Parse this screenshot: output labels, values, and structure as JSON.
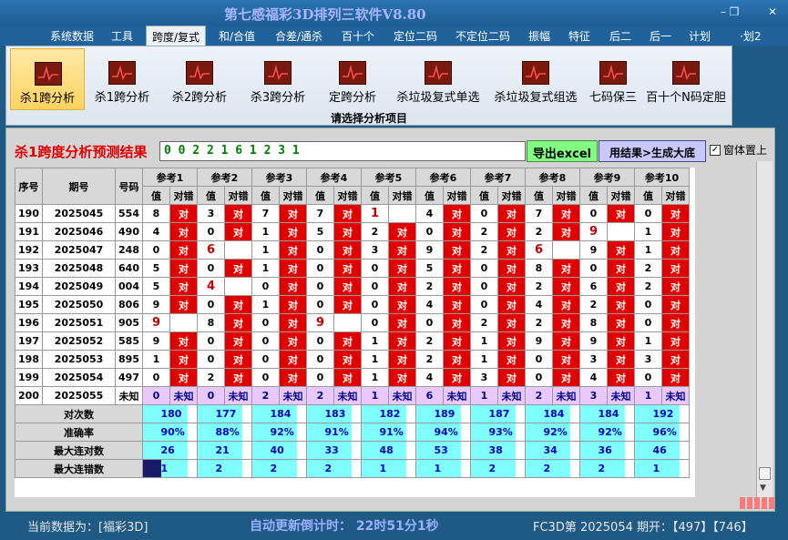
{
  "window": {
    "title": "第七感福彩3D排列三软件V8.80",
    "controls": [
      "–",
      "❐",
      "✕"
    ]
  },
  "menu": [
    "系统数据",
    "工具",
    "跨度/复式",
    "和/合值",
    "合差/通杀",
    "百十个",
    "定位二码",
    "不定位二码",
    "振幅",
    "特征",
    "后二",
    "后一",
    "计划",
    "·划2"
  ],
  "menu_active": 2,
  "ribbon": {
    "tools": [
      "杀1跨分析",
      "杀1跨分析",
      "杀2跨分析",
      "杀3跨分析",
      "定跨分析",
      "杀垃圾复式单选",
      "杀垃圾复式组选",
      "七码保三",
      "百十个N码定胆"
    ],
    "active": 0,
    "caption": "请选择分析项目"
  },
  "panel": {
    "title": "杀1跨度分析预测结果",
    "result": "0 0 2 2 1 6 1 2 3 1",
    "excel_button": "导出excel",
    "gen_button": "用结果>生成大底",
    "ontop_label": "窗体置上",
    "ontop_checked": "✓"
  },
  "table": {
    "headers": {
      "idx": "序号",
      "period": "期号",
      "num": "号码",
      "refs": [
        "参考1",
        "参考2",
        "参考3",
        "参考4",
        "参考5",
        "参考6",
        "参考7",
        "参考8",
        "参考9",
        "参考10"
      ],
      "val": "值",
      "hit": "对错"
    },
    "rows": [
      {
        "idx": "190",
        "period": "2025045",
        "num": "554",
        "cells": [
          [
            "8",
            "对"
          ],
          [
            "3",
            "对"
          ],
          [
            "7",
            "对"
          ],
          [
            "7",
            "对"
          ],
          [
            "1",
            ""
          ],
          [
            "4",
            "对"
          ],
          [
            "0",
            "对"
          ],
          [
            "7",
            "对"
          ],
          [
            "0",
            "对"
          ],
          [
            "0",
            "对"
          ]
        ]
      },
      {
        "idx": "191",
        "period": "2025046",
        "num": "490",
        "cells": [
          [
            "4",
            "对"
          ],
          [
            "0",
            "对"
          ],
          [
            "1",
            "对"
          ],
          [
            "5",
            "对"
          ],
          [
            "2",
            "对"
          ],
          [
            "0",
            "对"
          ],
          [
            "2",
            "对"
          ],
          [
            "2",
            "对"
          ],
          [
            "9",
            ""
          ],
          [
            "1",
            "对"
          ]
        ]
      },
      {
        "idx": "192",
        "period": "2025047",
        "num": "248",
        "cells": [
          [
            "0",
            "对"
          ],
          [
            "6",
            ""
          ],
          [
            "1",
            "对"
          ],
          [
            "0",
            "对"
          ],
          [
            "3",
            "对"
          ],
          [
            "9",
            "对"
          ],
          [
            "2",
            "对"
          ],
          [
            "6",
            ""
          ],
          [
            "9",
            "对"
          ],
          [
            "1",
            "对"
          ]
        ]
      },
      {
        "idx": "193",
        "period": "2025048",
        "num": "640",
        "cells": [
          [
            "5",
            "对"
          ],
          [
            "0",
            "对"
          ],
          [
            "1",
            "对"
          ],
          [
            "0",
            "对"
          ],
          [
            "0",
            "对"
          ],
          [
            "5",
            "对"
          ],
          [
            "0",
            "对"
          ],
          [
            "8",
            "对"
          ],
          [
            "0",
            "对"
          ],
          [
            "2",
            "对"
          ]
        ]
      },
      {
        "idx": "194",
        "period": "2025049",
        "num": "004",
        "cells": [
          [
            "5",
            "对"
          ],
          [
            "4",
            ""
          ],
          [
            "0",
            "对"
          ],
          [
            "0",
            "对"
          ],
          [
            "0",
            "对"
          ],
          [
            "2",
            "对"
          ],
          [
            "0",
            "对"
          ],
          [
            "2",
            "对"
          ],
          [
            "6",
            "对"
          ],
          [
            "2",
            "对"
          ]
        ]
      },
      {
        "idx": "195",
        "period": "2025050",
        "num": "806",
        "cells": [
          [
            "9",
            "对"
          ],
          [
            "0",
            "对"
          ],
          [
            "1",
            "对"
          ],
          [
            "0",
            "对"
          ],
          [
            "0",
            "对"
          ],
          [
            "4",
            "对"
          ],
          [
            "0",
            "对"
          ],
          [
            "4",
            "对"
          ],
          [
            "2",
            "对"
          ],
          [
            "0",
            "对"
          ]
        ]
      },
      {
        "idx": "196",
        "period": "2025051",
        "num": "905",
        "cells": [
          [
            "9",
            ""
          ],
          [
            "8",
            "对"
          ],
          [
            "0",
            "对"
          ],
          [
            "9",
            ""
          ],
          [
            "0",
            "对"
          ],
          [
            "0",
            "对"
          ],
          [
            "2",
            "对"
          ],
          [
            "2",
            "对"
          ],
          [
            "8",
            "对"
          ],
          [
            "0",
            "对"
          ]
        ]
      },
      {
        "idx": "197",
        "period": "2025052",
        "num": "585",
        "cells": [
          [
            "9",
            "对"
          ],
          [
            "0",
            "对"
          ],
          [
            "0",
            "对"
          ],
          [
            "0",
            "对"
          ],
          [
            "1",
            "对"
          ],
          [
            "2",
            "对"
          ],
          [
            "1",
            "对"
          ],
          [
            "9",
            "对"
          ],
          [
            "9",
            "对"
          ],
          [
            "1",
            "对"
          ]
        ]
      },
      {
        "idx": "198",
        "period": "2025053",
        "num": "895",
        "cells": [
          [
            "1",
            "对"
          ],
          [
            "0",
            "对"
          ],
          [
            "0",
            "对"
          ],
          [
            "0",
            "对"
          ],
          [
            "1",
            "对"
          ],
          [
            "2",
            "对"
          ],
          [
            "1",
            "对"
          ],
          [
            "0",
            "对"
          ],
          [
            "3",
            "对"
          ],
          [
            "3",
            "对"
          ]
        ]
      },
      {
        "idx": "199",
        "period": "2025054",
        "num": "497",
        "cells": [
          [
            "0",
            "对"
          ],
          [
            "2",
            "对"
          ],
          [
            "0",
            "对"
          ],
          [
            "0",
            "对"
          ],
          [
            "1",
            "对"
          ],
          [
            "4",
            "对"
          ],
          [
            "3",
            "对"
          ],
          [
            "0",
            "对"
          ],
          [
            "4",
            "对"
          ],
          [
            "0",
            "对"
          ]
        ]
      },
      {
        "idx": "200",
        "period": "2025055",
        "num": "未知",
        "cells": [
          [
            "0",
            "未知"
          ],
          [
            "0",
            "未知"
          ],
          [
            "2",
            "未知"
          ],
          [
            "2",
            "未知"
          ],
          [
            "1",
            "未知"
          ],
          [
            "6",
            "未知"
          ],
          [
            "1",
            "未知"
          ],
          [
            "2",
            "未知"
          ],
          [
            "3",
            "未知"
          ],
          [
            "1",
            "未知"
          ]
        ]
      }
    ],
    "stats": [
      {
        "label": "对次数",
        "values": [
          "180",
          "177",
          "184",
          "183",
          "182",
          "189",
          "187",
          "184",
          "184",
          "192"
        ]
      },
      {
        "label": "准确率",
        "values": [
          "90%",
          "88%",
          "92%",
          "91%",
          "91%",
          "94%",
          "93%",
          "92%",
          "92%",
          "96%"
        ]
      },
      {
        "label": "最大连对数",
        "values": [
          "26",
          "21",
          "40",
          "33",
          "48",
          "53",
          "38",
          "34",
          "36",
          "46"
        ]
      },
      {
        "label": "最大连错数",
        "values": [
          "1",
          "2",
          "2",
          "2",
          "1",
          "1",
          "2",
          "2",
          "2",
          "1"
        ]
      }
    ]
  },
  "status": {
    "left": "当前数据为：[福彩3D]",
    "mid": "自动更新倒计时：  22时51分1秒",
    "right": "FC3D第 2025054 期开：【497】【746】"
  },
  "colors": {
    "hit": "#e00000",
    "stat": "#80ffff",
    "last_row": "#e8c8ff"
  }
}
